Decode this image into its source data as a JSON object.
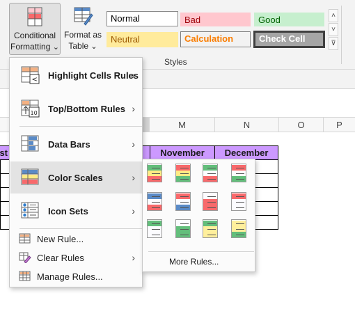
{
  "ribbon": {
    "conditional_formatting": {
      "line1": "Conditional",
      "line2": "Formatting"
    },
    "format_as_table": {
      "line1": "Format as",
      "line2": "Table"
    },
    "dropdown_arrow": "⌄",
    "styles": {
      "normal": "Normal",
      "bad": "Bad",
      "good": "Good",
      "neutral": "Neutral",
      "calculation": "Calculation",
      "check_cell": "Check Cell"
    },
    "group_label": "Styles",
    "scroll_up": "˄",
    "scroll_down": "˅",
    "more": "⊽"
  },
  "sheet": {
    "columns": [
      {
        "label": "L"
      },
      {
        "label": "M"
      },
      {
        "label": "N"
      },
      {
        "label": "O"
      },
      {
        "label": "P"
      }
    ],
    "headers": {
      "first_partial": "st",
      "november": "November",
      "december": "December"
    }
  },
  "menu": {
    "items": [
      {
        "label": "Highlight Cells Rules",
        "icon": "highlight-cells-icon",
        "has_submenu": true
      },
      {
        "label": "Top/Bottom Rules",
        "icon": "top-bottom-icon",
        "has_submenu": true
      },
      {
        "label": "Data Bars",
        "icon": "data-bars-icon",
        "has_submenu": true
      },
      {
        "label": "Color Scales",
        "icon": "color-scales-icon",
        "has_submenu": true
      },
      {
        "label": "Icon Sets",
        "icon": "icon-sets-icon",
        "has_submenu": true
      }
    ],
    "small_items": [
      {
        "label": "New Rule...",
        "icon": "new-rule-icon",
        "has_submenu": false
      },
      {
        "label": "Clear Rules",
        "icon": "clear-rules-icon",
        "has_submenu": true
      },
      {
        "label": "Manage Rules...",
        "icon": "manage-rules-icon",
        "has_submenu": false
      }
    ],
    "submenu_arrow": "›"
  },
  "color_scales": {
    "more_rules": "More Rules...",
    "swatches": [
      [
        "#63be7b",
        "#ffeb84",
        "#f8696b"
      ],
      [
        "#f8696b",
        "#ffeb84",
        "#63be7b"
      ],
      [
        "#63be7b",
        "#fcfcff",
        "#f8696b"
      ],
      [
        "#f8696b",
        "#fcfcff",
        "#63be7b"
      ],
      [
        "#5a8ac6",
        "#fcfcff",
        "#f8696b"
      ],
      [
        "#f8696b",
        "#fcfcff",
        "#5a8ac6"
      ],
      [
        "#fcfcff",
        "#f8696b",
        "#f8696b"
      ],
      [
        "#f8696b",
        "#fcfcff",
        "#fcfcff"
      ],
      [
        "#63be7b",
        "#fcfcff",
        "#fcfcff"
      ],
      [
        "#fcfcff",
        "#63be7b",
        "#63be7b"
      ],
      [
        "#63be7b",
        "#ffef9c",
        "#ffef9c"
      ],
      [
        "#ffef9c",
        "#ffef9c",
        "#63be7b"
      ]
    ]
  }
}
